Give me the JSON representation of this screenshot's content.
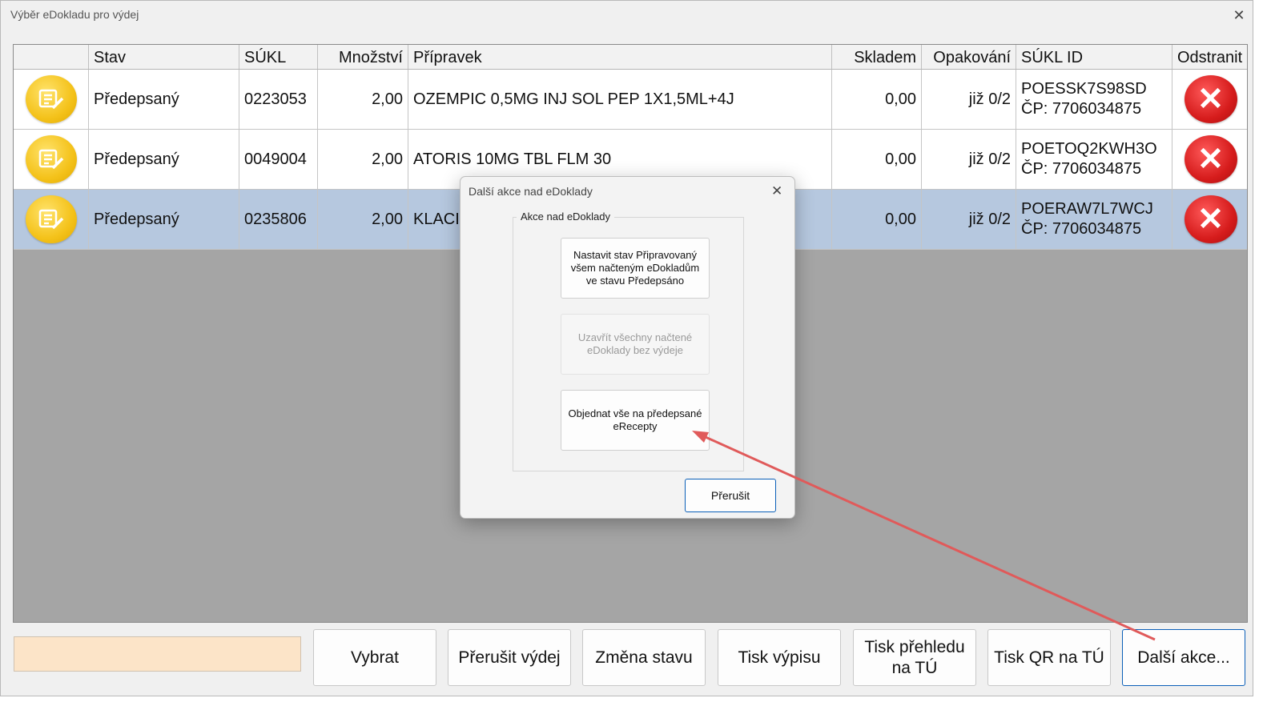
{
  "window": {
    "title": "Výběr eDokladu pro výdej",
    "close": "✕"
  },
  "grid": {
    "columns": [
      "",
      "Stav",
      "SÚKL",
      "Množství",
      "Přípravek",
      "Skladem",
      "Opakování",
      "SÚKL ID",
      "Odstranit"
    ],
    "rows": [
      {
        "stav": "Předepsaný",
        "sukl": "0223053",
        "mnozstvi": "2,00",
        "pripravek": "OZEMPIC 0,5MG INJ SOL PEP 1X1,5ML+4J",
        "skladem": "0,00",
        "opakovani": "již 0/2",
        "sukl_id": "POESSK7S98SD",
        "cp": "ČP: 7706034875",
        "selected": false
      },
      {
        "stav": "Předepsaný",
        "sukl": "0049004",
        "mnozstvi": "2,00",
        "pripravek": "ATORIS 10MG TBL FLM 30",
        "skladem": "0,00",
        "opakovani": "již 0/2",
        "sukl_id": "POETOQ2KWH3O",
        "cp": "ČP: 7706034875",
        "selected": false
      },
      {
        "stav": "Předepsaný",
        "sukl": "0235806",
        "mnozstvi": "2,00",
        "pripravek": "KLACI",
        "skladem": "0,00",
        "opakovani": "již 0/2",
        "sukl_id": "POERAW7L7WCJ",
        "cp": "ČP: 7706034875",
        "selected": true
      }
    ]
  },
  "bottom": {
    "input_value": "",
    "buttons": [
      "Vybrat",
      "Přerušit výdej",
      "Změna stavu",
      "Tisk výpisu",
      "Tisk přehledu\nna TÚ",
      "Tisk QR na TÚ",
      "Další akce..."
    ]
  },
  "dialog": {
    "title": "Další akce nad eDoklady",
    "close": "✕",
    "group_label": "Akce nad eDoklady",
    "btn_set_state": "Nastavit stav Připravovaný všem načteným eDokladům ve stavu Předepsáno",
    "btn_close_all": "Uzavřít všechny načtené eDoklady bez výdeje",
    "btn_order_all": "Objednat vše na předepsané eRecepty",
    "btn_cancel": "Přerušit"
  },
  "colors": {
    "selected_row": "#b6c8df",
    "input_bg": "#fce4c8",
    "arrow": "#e05a5a",
    "focus_border": "#0a5fb8"
  },
  "icons": {
    "doc": "document-edit-icon",
    "delete": "delete-x-icon"
  }
}
